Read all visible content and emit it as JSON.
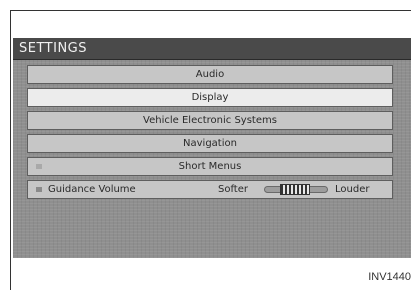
{
  "header": {
    "title": "SETTINGS"
  },
  "menu": {
    "items": [
      {
        "label": "Audio"
      },
      {
        "label": "Display"
      },
      {
        "label": "Vehicle Electronic Systems"
      },
      {
        "label": "Navigation"
      },
      {
        "label": "Short Menus"
      }
    ],
    "selected_index": 1
  },
  "volume": {
    "label": "Guidance Volume",
    "softer_label": "Softer",
    "louder_label": "Louder",
    "level": 0.5
  },
  "caption": "INV1440"
}
